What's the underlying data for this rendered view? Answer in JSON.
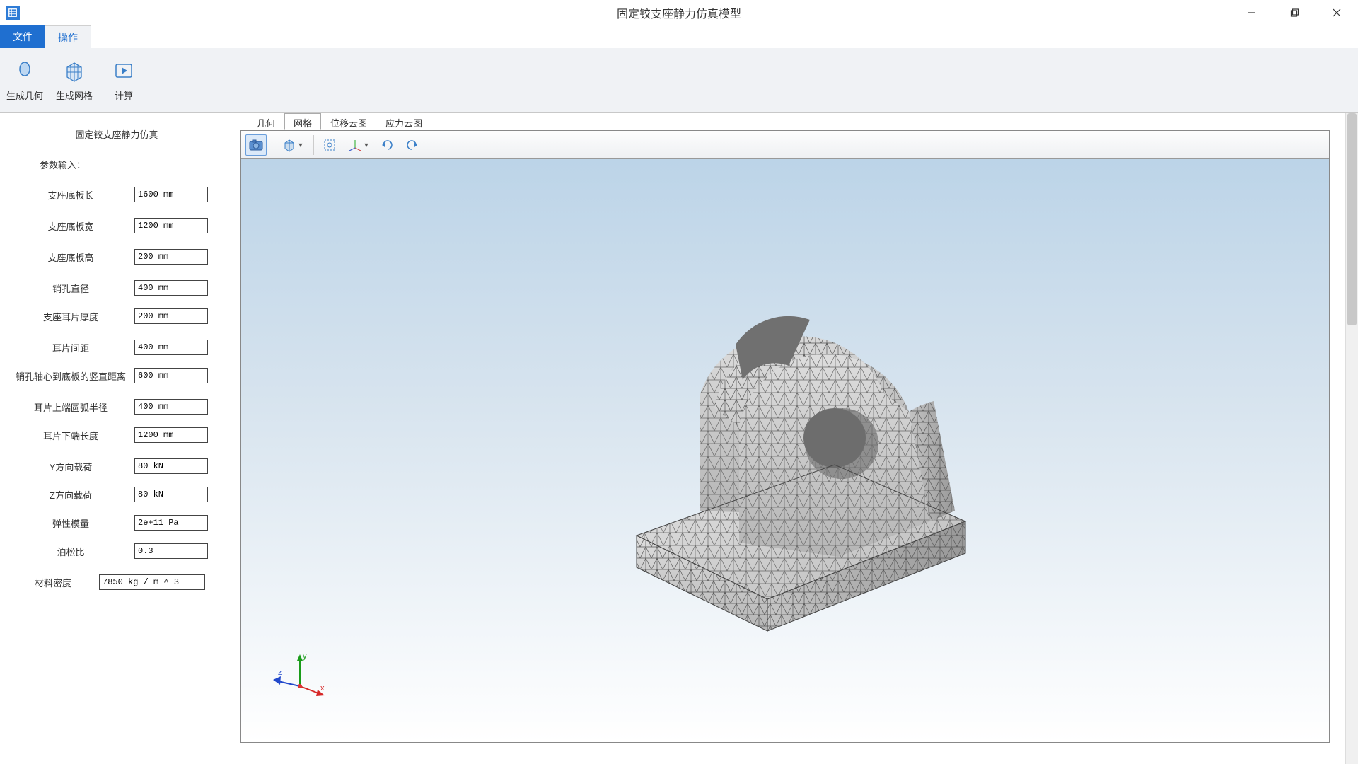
{
  "titlebar": {
    "title": "固定铰支座静力仿真模型"
  },
  "menu": {
    "file": "文件",
    "ops": "操作"
  },
  "ribbon": {
    "gen_geom": "生成几何",
    "gen_mesh": "生成网格",
    "compute": "计算"
  },
  "panel": {
    "title": "固定铰支座静力仿真",
    "subtitle": "参数输入：",
    "rows": [
      {
        "label": "支座底板长",
        "value": "1600 mm"
      },
      {
        "label": "支座底板宽",
        "value": "1200 mm"
      },
      {
        "label": "支座底板高",
        "value": "200 mm"
      },
      {
        "label": "销孔直径",
        "value": "400 mm"
      },
      {
        "label": "支座耳片厚度",
        "value": "200 mm"
      },
      {
        "label": "耳片间距",
        "value": "400 mm"
      },
      {
        "label": "销孔轴心到底板的竖直距离",
        "value": "600 mm"
      },
      {
        "label": "耳片上端圆弧半径",
        "value": "400 mm"
      },
      {
        "label": "耳片下端长度",
        "value": "1200 mm"
      },
      {
        "label": "Y方向载荷",
        "value": "80 kN"
      },
      {
        "label": "Z方向载荷",
        "value": "80 kN"
      },
      {
        "label": "弹性模量",
        "value": "2e+11 Pa"
      },
      {
        "label": "泊松比",
        "value": "0.3"
      }
    ],
    "last": {
      "label": "材料密度",
      "value": "7850 kg / m ^ 3"
    }
  },
  "view_tabs": {
    "geom": "几何",
    "mesh": "网格",
    "disp": "位移云图",
    "stress": "应力云图"
  },
  "axis": {
    "x": "x",
    "y": "y",
    "z": "z"
  }
}
